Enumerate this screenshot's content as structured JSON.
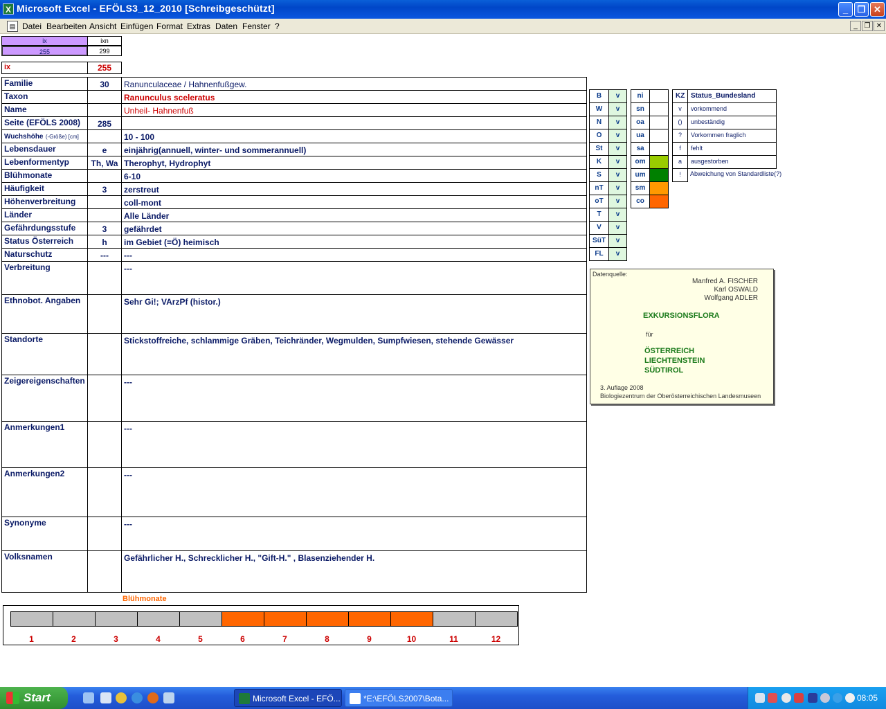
{
  "window": {
    "title": "Microsoft Excel - EFÖLS3_12_2010  [Schreibgeschützt]",
    "app_glyph": "X"
  },
  "menu": [
    "Datei",
    "Bearbeiten",
    "Ansicht",
    "Einfügen",
    "Format",
    "Extras",
    "Daten",
    "Fenster",
    "?"
  ],
  "titlebar_buttons": {
    "minimize": "_",
    "restore": "❐",
    "close": "✕"
  },
  "doc_buttons": {
    "minimize": "_",
    "restore": "❐",
    "close": "✕"
  },
  "index_box": {
    "h1": "ix",
    "h2": "ixn",
    "v1": "255",
    "v2": "299"
  },
  "ix": {
    "label": "ix",
    "value": "255"
  },
  "rows": [
    {
      "label": "Familie",
      "mid": "30",
      "value": "Ranunculaceae  /  Hahnenfußgew."
    },
    {
      "label": "Taxon",
      "mid": "",
      "value": "Ranunculus sceleratus"
    },
    {
      "label": "Name",
      "mid": "",
      "value": "Unheil- Hahnenfuß"
    },
    {
      "label": "Seite (EFÖLS 2008)",
      "mid": "285",
      "value": ""
    },
    {
      "label": "Wuchshöhe",
      "label_small": "(-Größe) [cm]",
      "mid": "",
      "value": " 10 - 100"
    },
    {
      "label": "Lebensdauer",
      "mid": "e",
      "value": "einjährig(annuell, winter- und sommerannuell)"
    },
    {
      "label": "Lebenformentyp",
      "mid": "Th, Wa",
      "value": "Therophyt, Hydrophyt"
    },
    {
      "label": "Blühmonate",
      "mid": "",
      "value": " 6-10"
    },
    {
      "label": "Häufigkeit",
      "mid": "3",
      "value": "zerstreut"
    },
    {
      "label": "Höhenverbreitung",
      "mid": "",
      "value": "coll-mont"
    },
    {
      "label": "Länder",
      "mid": "",
      "value": "Alle Länder"
    },
    {
      "label": "Gefährdungsstufe",
      "mid": "3",
      "value": "gefährdet"
    },
    {
      "label": "Status Österreich",
      "mid": "h",
      "value": "im Gebiet (=Ö) heimisch"
    },
    {
      "label": "Naturschutz",
      "mid": "---",
      "value": "---"
    },
    {
      "label": "Verbreitung",
      "mid": "",
      "value": "---"
    },
    {
      "label": "Ethnobot. Angaben",
      "mid": "",
      "value": "Sehr Gi!; VArzPf (histor.)"
    },
    {
      "label": "Standorte",
      "mid": "",
      "value": "Stickstoffreiche, schlammige Gräben, Teichränder, Wegmulden, Sumpfwiesen, stehende Gewässer"
    },
    {
      "label": "Zeigereigenschaften",
      "mid": "",
      "value": "---"
    },
    {
      "label": "Anmerkungen1",
      "mid": "",
      "value": "---"
    },
    {
      "label": "Anmerkungen2",
      "mid": "",
      "value": "---"
    },
    {
      "label": "Synonyme",
      "mid": "",
      "value": "---"
    },
    {
      "label": "Volksnamen",
      "mid": "",
      "value": "Gefährlicher H., Schrecklicher H.,   \"Gift-H.\" , Blasenziehender H."
    }
  ],
  "bundesland": [
    {
      "code": "B",
      "status": "v"
    },
    {
      "code": "W",
      "status": "v"
    },
    {
      "code": "N",
      "status": "v"
    },
    {
      "code": "O",
      "status": "v"
    },
    {
      "code": "St",
      "status": "v"
    },
    {
      "code": "K",
      "status": "v"
    },
    {
      "code": "S",
      "status": "v"
    },
    {
      "code": "nT",
      "status": "v"
    },
    {
      "code": "oT",
      "status": "v"
    },
    {
      "code": "T",
      "status": "v"
    },
    {
      "code": "V",
      "status": "v"
    },
    {
      "code": "SüT",
      "status": "v"
    },
    {
      "code": "FL",
      "status": "v"
    }
  ],
  "altitude": [
    {
      "code": "ni",
      "color": ""
    },
    {
      "code": "sn",
      "color": ""
    },
    {
      "code": "oa",
      "color": ""
    },
    {
      "code": "ua",
      "color": ""
    },
    {
      "code": "sa",
      "color": ""
    },
    {
      "code": "om",
      "color": "#99cc00"
    },
    {
      "code": "um",
      "color": "#008000"
    },
    {
      "code": "sm",
      "color": "#ff9900"
    },
    {
      "code": "co",
      "color": "#ff6600"
    }
  ],
  "kz_legend": {
    "header_code": "KZ",
    "header_text": "Status_Bundesland",
    "items": [
      {
        "code": "v",
        "text": "vorkommend"
      },
      {
        "code": "()",
        "text": "unbeständig"
      },
      {
        "code": "?",
        "text": "Vorkommen fraglich"
      },
      {
        "code": "f",
        "text": "fehlt"
      },
      {
        "code": "a",
        "text": "ausgestorben"
      },
      {
        "code": "!",
        "text": "Abweichung von Standardliste(?)"
      }
    ]
  },
  "source": {
    "label": "Datenquelle:",
    "authors": [
      "Manfred A. FISCHER",
      "Karl OSWALD",
      "Wolfgang ADLER"
    ],
    "book": "EXKURSIONSFLORA",
    "fuer": "für",
    "countries": [
      "ÖSTERREICH",
      "LIECHTENSTEIN",
      "SÜDTIROL"
    ],
    "edition": "3. Auflage 2008",
    "publisher": "Biologiezentrum der Oberösterreichischen Landesmuseen"
  },
  "bloom": {
    "title": "Blühmonate",
    "months": [
      "1",
      "2",
      "3",
      "4",
      "5",
      "6",
      "7",
      "8",
      "9",
      "10",
      "11",
      "12"
    ],
    "active": [
      false,
      false,
      false,
      false,
      false,
      true,
      true,
      true,
      true,
      true,
      false,
      false
    ],
    "active_color": "#ff6600",
    "inactive_color": "#c0c0c0"
  },
  "taskbar": {
    "start": "Start",
    "tasks": [
      "Microsoft Excel - EFÖ...",
      "*E:\\EFÖLS2007\\Bota..."
    ],
    "clock": "08:05"
  }
}
